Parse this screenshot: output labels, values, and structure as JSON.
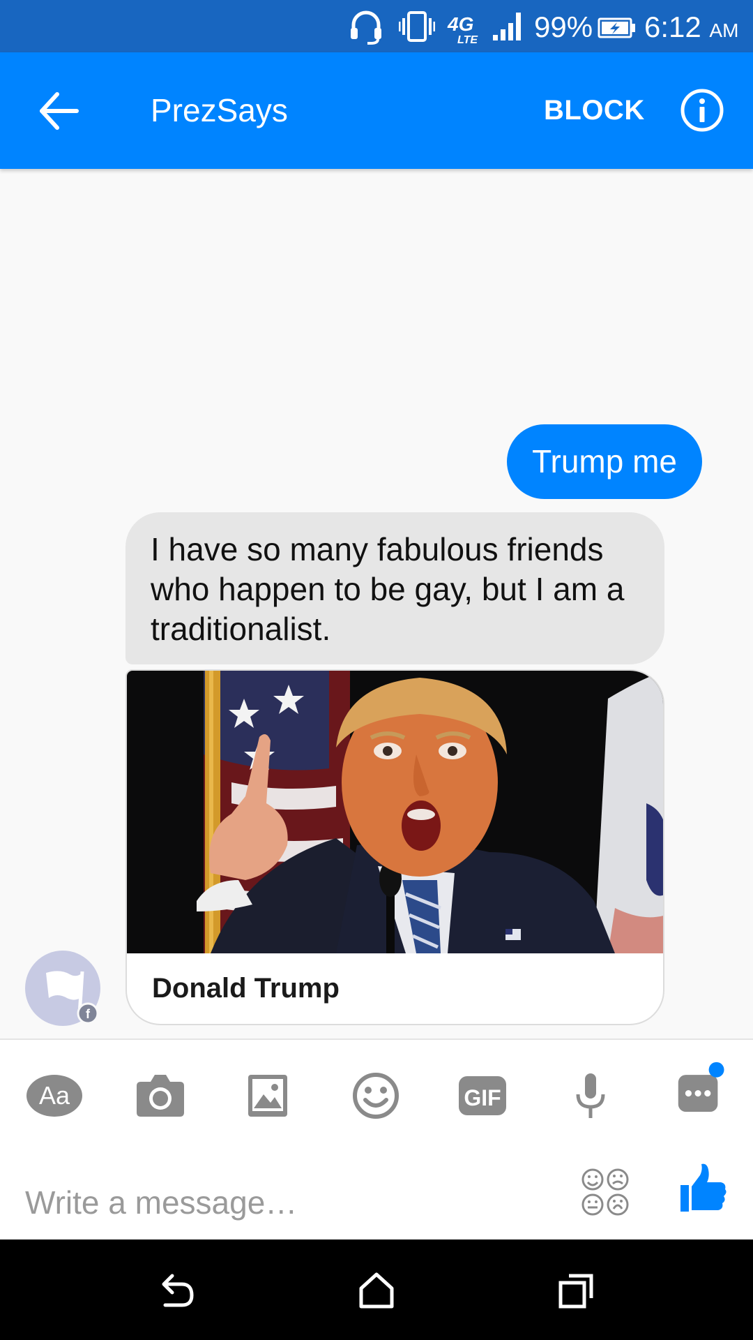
{
  "status_bar": {
    "battery": "99%",
    "time": "6:12",
    "ampm": "AM",
    "network": "4G LTE",
    "icons": [
      "headset-icon",
      "vibrate-icon",
      "4g-lte-icon",
      "signal-icon",
      "battery-charging-icon"
    ]
  },
  "app_bar": {
    "title": "PrezSays",
    "block_label": "BLOCK",
    "icons": [
      "back-arrow-icon",
      "info-icon"
    ]
  },
  "conversation": {
    "outgoing_message": "Trump me",
    "incoming_message": "I have so many fabulous friends who happen to be gay, but I am a traditionalist.",
    "card_caption": "Donald Trump"
  },
  "composer": {
    "placeholder": "Write a message…",
    "tools": [
      "text-format-icon",
      "camera-icon",
      "gallery-icon",
      "emoji-icon",
      "gif-icon",
      "microphone-icon",
      "more-icon"
    ],
    "text_tool_label": "Aa",
    "gif_label": "GIF"
  },
  "nav_bar": {
    "icons": [
      "back-icon",
      "home-icon",
      "recents-icon"
    ]
  },
  "colors": {
    "status_bar": "#1866c0",
    "accent": "#0084ff",
    "incoming_bubble": "#e6e6e6",
    "tool_icon": "#8a8a8a",
    "notification_dot": "#0084ff"
  }
}
